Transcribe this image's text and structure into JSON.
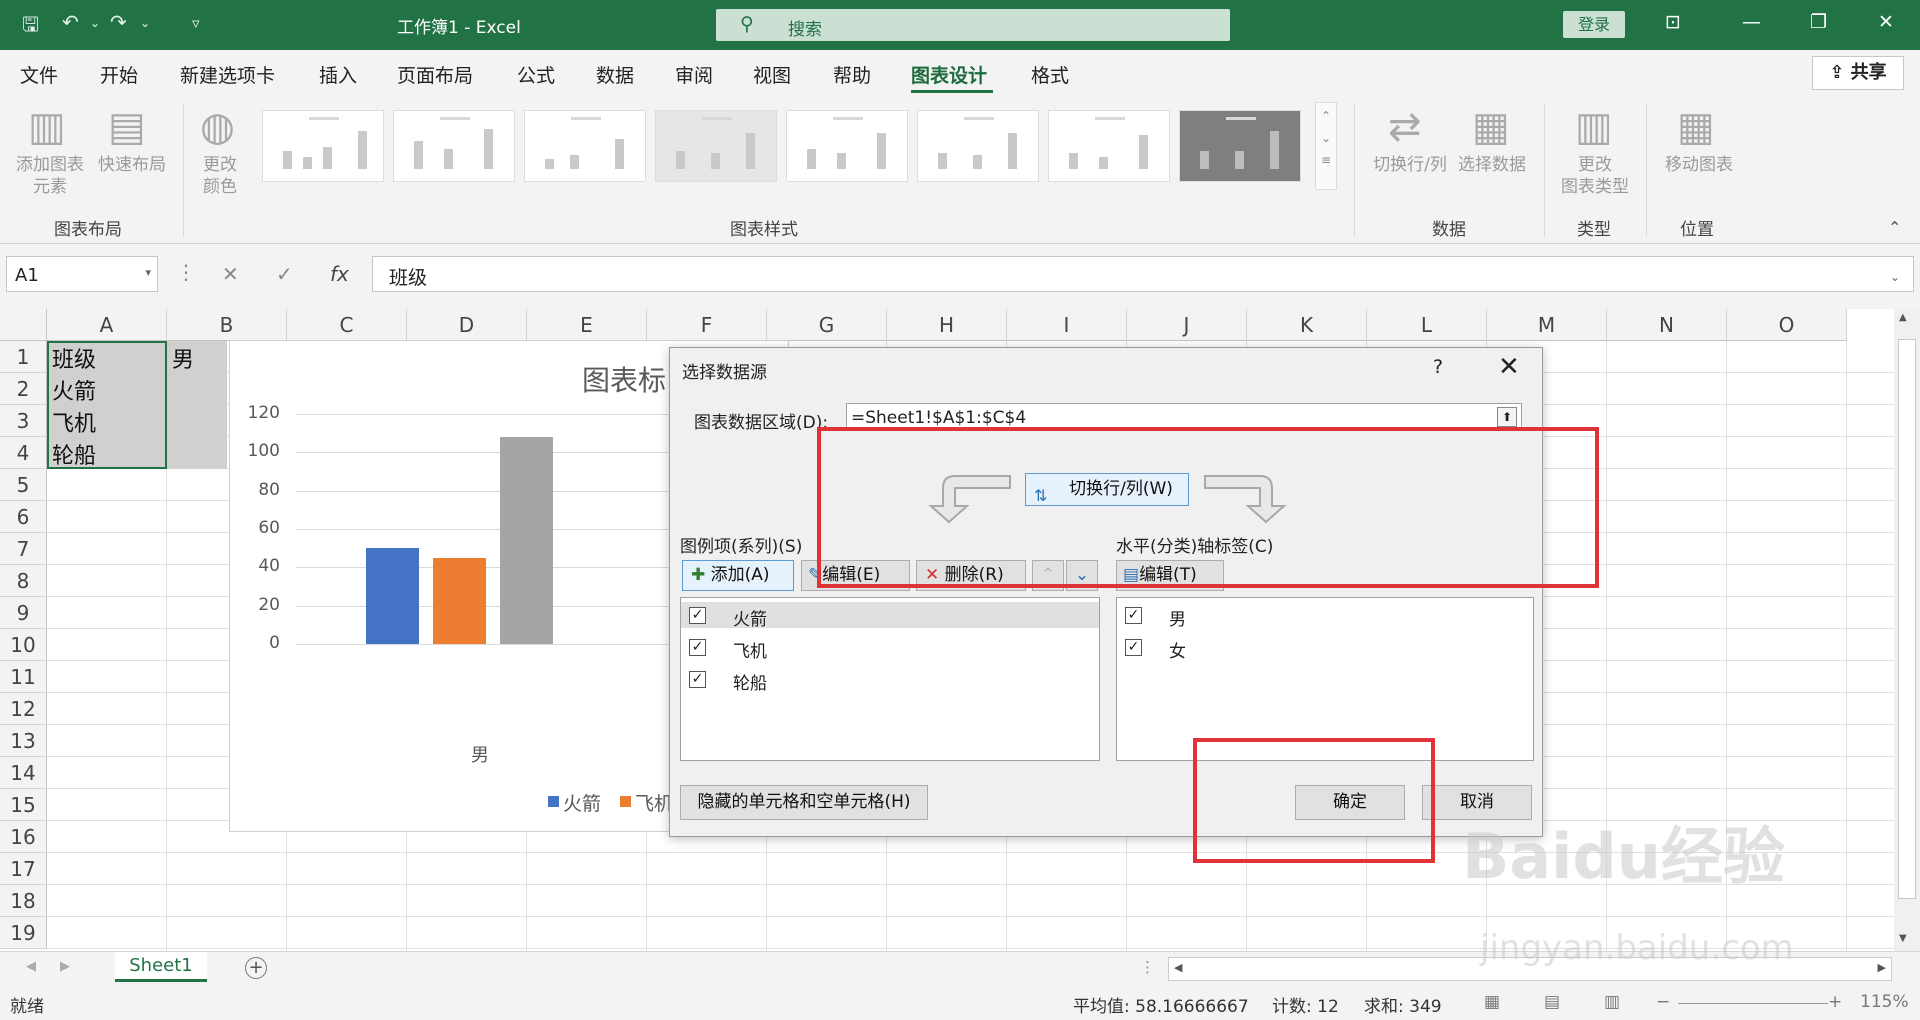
{
  "titlebar": {
    "title": "工作簿1  -  Excel",
    "search_placeholder": "搜索",
    "login": "登录"
  },
  "menu": {
    "items": [
      "文件",
      "开始",
      "新建选项卡",
      "插入",
      "页面布局",
      "公式",
      "数据",
      "审阅",
      "视图",
      "帮助",
      "图表设计",
      "格式"
    ],
    "active": "图表设计",
    "share": "共享"
  },
  "ribbon": {
    "add_element": [
      "添加图表",
      "元素"
    ],
    "quick_layout": "快速布局",
    "change_color": [
      "更改",
      "颜色"
    ],
    "switch_rowcol": "切换行/列",
    "select_data": "选择数据",
    "change_type": [
      "更改",
      "图表类型"
    ],
    "move_chart": "移动图表",
    "groups": {
      "layout": "图表布局",
      "styles": "图表样式",
      "data": "数据",
      "type": "类型",
      "location": "位置"
    }
  },
  "formula_bar": {
    "name_box": "A1",
    "content": "班级"
  },
  "grid": {
    "columns": [
      "A",
      "B",
      "C",
      "D",
      "E",
      "F",
      "G",
      "H",
      "I",
      "J",
      "K",
      "L",
      "M",
      "N",
      "O"
    ],
    "rows": [
      "1",
      "2",
      "3",
      "4",
      "5",
      "6",
      "7",
      "8",
      "9",
      "10",
      "11",
      "12",
      "13",
      "14",
      "15",
      "16",
      "17",
      "18",
      "19"
    ],
    "cells": {
      "A1": "班级",
      "B1": "男",
      "A2": "火箭",
      "A3": "飞机",
      "A4": "轮船"
    }
  },
  "chart_data": {
    "type": "bar",
    "title": "图表标",
    "categories": [
      "男"
    ],
    "series": [
      {
        "name": "火箭",
        "values": [
          50
        ],
        "color": "#4472c4"
      },
      {
        "name": "飞机",
        "values": [
          45
        ],
        "color": "#ed7d31"
      },
      {
        "name": "轮船",
        "values": [
          108
        ],
        "color": "#a5a5a5"
      }
    ],
    "yticks": [
      "120",
      "100",
      "80",
      "60",
      "40",
      "20",
      "0"
    ],
    "ylim": [
      0,
      120
    ],
    "legend_visible": [
      "火箭",
      "飞机"
    ],
    "legend_position": "bottom"
  },
  "dialog": {
    "title": "选择数据源",
    "help": "?",
    "close": "✕",
    "range_label": "图表数据区域(D):",
    "range_value": "=Sheet1!$A$1:$C$4",
    "switch_button": "切换行/列(W)",
    "series_label": "图例项(系列)(S)",
    "axis_label": "水平(分类)轴标签(C)",
    "add": "添加(A)",
    "edit": "编辑(E)",
    "remove": "删除(R)",
    "axis_edit": "编辑(T)",
    "series": [
      "火箭",
      "飞机",
      "轮船"
    ],
    "axis_items": [
      "男",
      "女"
    ],
    "hidden_cells": "隐藏的单元格和空单元格(H)",
    "ok": "确定",
    "cancel": "取消"
  },
  "sheet_tabs": {
    "active": "Sheet1",
    "add": "+"
  },
  "status": {
    "ready": "就绪",
    "average": "平均值: 58.16666667",
    "count": "计数: 12",
    "sum": "求和: 349",
    "zoom": "115%"
  },
  "colors": {
    "accent": "#217346",
    "highlight": "#e03338"
  },
  "watermark": {
    "logo": "Baidu经验",
    "url": "jingyan.baidu.com"
  }
}
